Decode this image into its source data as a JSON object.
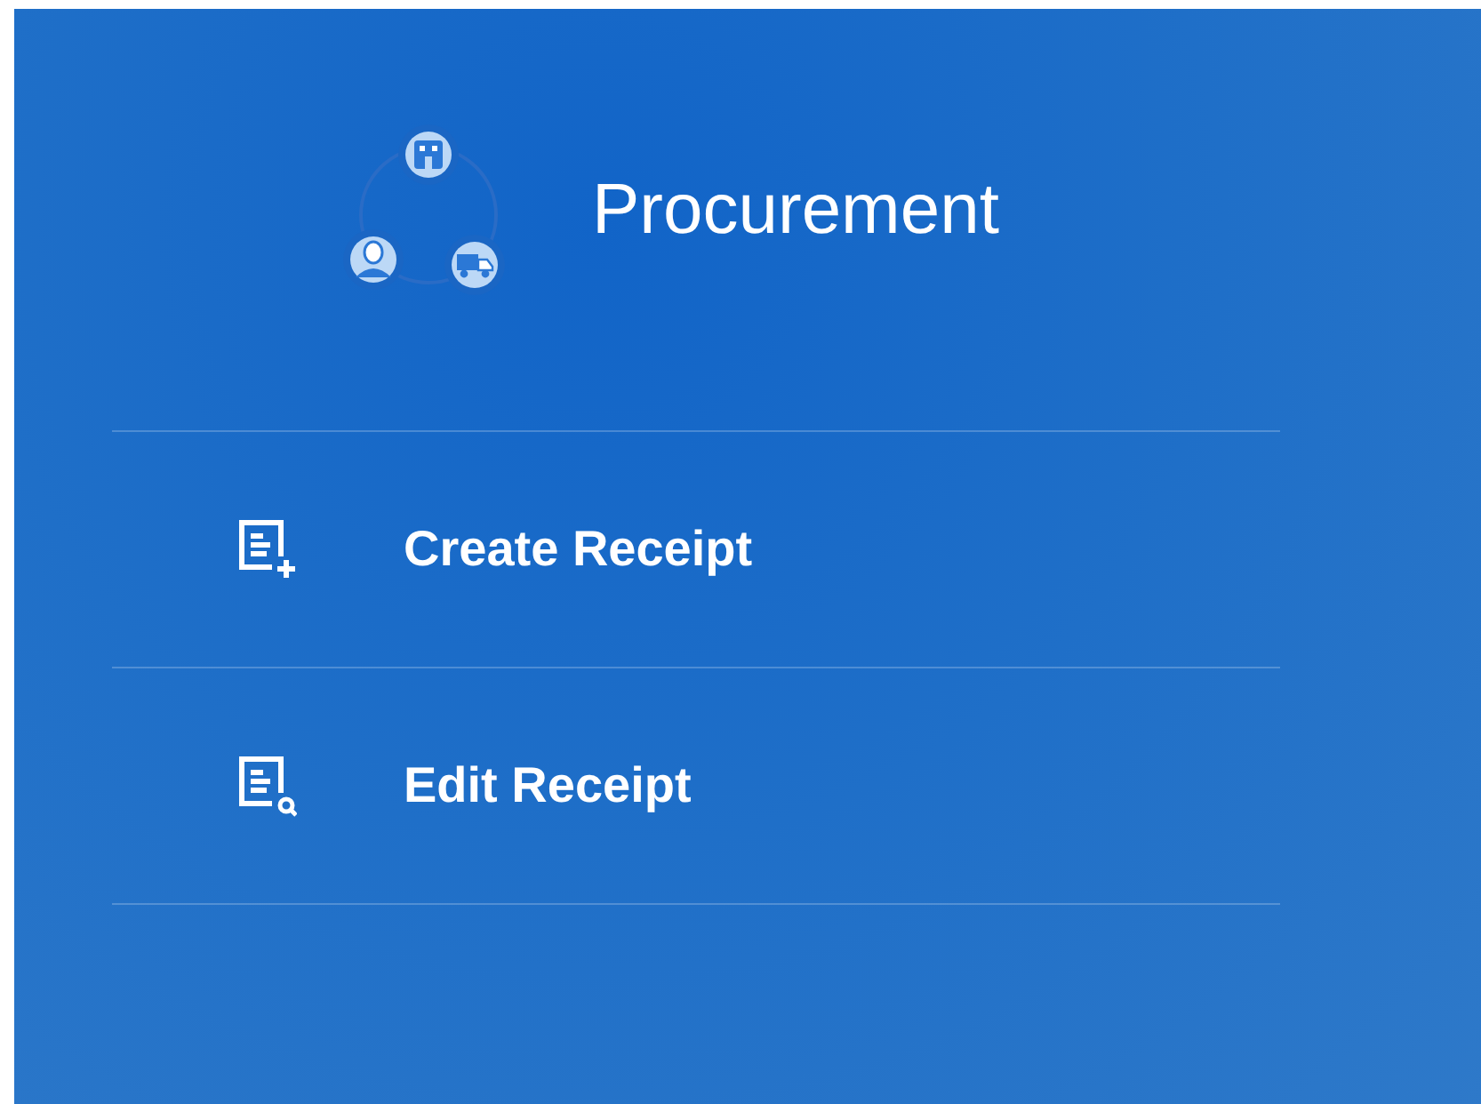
{
  "header": {
    "title": "Procurement"
  },
  "menu": [
    {
      "label": "Create Receipt",
      "kind": "add"
    },
    {
      "label": "Edit Receipt",
      "kind": "search"
    }
  ]
}
